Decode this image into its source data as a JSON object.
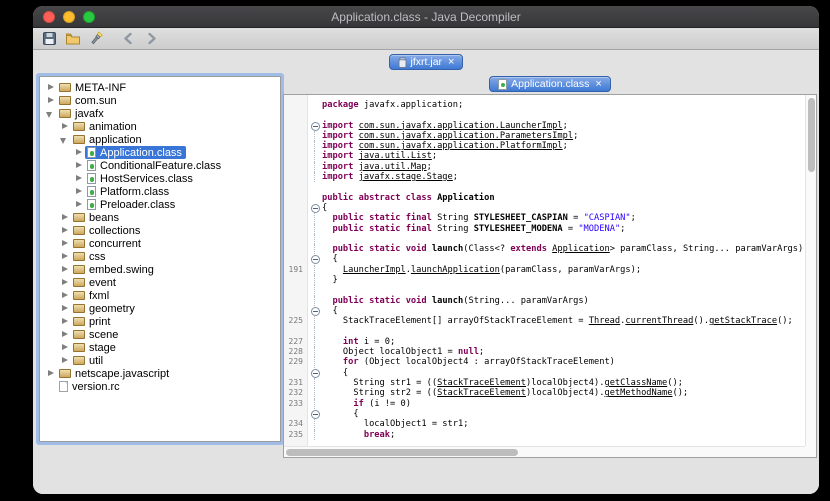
{
  "window": {
    "title": "Application.class - Java Decompiler"
  },
  "toolbar": {
    "icons": [
      "save-icon",
      "open-folder-icon",
      "search-flashlight-icon",
      "back-icon",
      "forward-icon"
    ]
  },
  "jar_tab": {
    "label": "jfxrt.jar",
    "close_glyph": "×"
  },
  "source_tab": {
    "label": "Application.class",
    "close_glyph": "×"
  },
  "colors": {
    "selection": "#3875d7",
    "tab_blue": "#3e79d6",
    "tab_blue_top": "#87aae6",
    "keyword": "#7f0055",
    "string": "#2a00ff",
    "traffic_red": "#ff5f57",
    "traffic_yellow": "#febc2e",
    "traffic_green": "#28c840"
  },
  "tree": {
    "items": [
      {
        "label": "META-INF",
        "depth": 0,
        "arrow": "right",
        "icon": "package"
      },
      {
        "label": "com.sun",
        "depth": 0,
        "arrow": "right",
        "icon": "package"
      },
      {
        "label": "javafx",
        "depth": 0,
        "arrow": "down",
        "icon": "package"
      },
      {
        "label": "animation",
        "depth": 1,
        "arrow": "right",
        "icon": "package"
      },
      {
        "label": "application",
        "depth": 1,
        "arrow": "down",
        "icon": "package"
      },
      {
        "label": "Application.class",
        "depth": 2,
        "arrow": "right",
        "icon": "class",
        "selected": true
      },
      {
        "label": "ConditionalFeature.class",
        "depth": 2,
        "arrow": "right",
        "icon": "class"
      },
      {
        "label": "HostServices.class",
        "depth": 2,
        "arrow": "right",
        "icon": "class"
      },
      {
        "label": "Platform.class",
        "depth": 2,
        "arrow": "right",
        "icon": "class"
      },
      {
        "label": "Preloader.class",
        "depth": 2,
        "arrow": "right",
        "icon": "class"
      },
      {
        "label": "beans",
        "depth": 1,
        "arrow": "right",
        "icon": "package"
      },
      {
        "label": "collections",
        "depth": 1,
        "arrow": "right",
        "icon": "package"
      },
      {
        "label": "concurrent",
        "depth": 1,
        "arrow": "right",
        "icon": "package"
      },
      {
        "label": "css",
        "depth": 1,
        "arrow": "right",
        "icon": "package"
      },
      {
        "label": "embed.swing",
        "depth": 1,
        "arrow": "right",
        "icon": "package"
      },
      {
        "label": "event",
        "depth": 1,
        "arrow": "right",
        "icon": "package"
      },
      {
        "label": "fxml",
        "depth": 1,
        "arrow": "right",
        "icon": "package"
      },
      {
        "label": "geometry",
        "depth": 1,
        "arrow": "right",
        "icon": "package"
      },
      {
        "label": "print",
        "depth": 1,
        "arrow": "right",
        "icon": "package"
      },
      {
        "label": "scene",
        "depth": 1,
        "arrow": "right",
        "icon": "package"
      },
      {
        "label": "stage",
        "depth": 1,
        "arrow": "right",
        "icon": "package"
      },
      {
        "label": "util",
        "depth": 1,
        "arrow": "right",
        "icon": "package"
      },
      {
        "label": "netscape.javascript",
        "depth": 0,
        "arrow": "right",
        "icon": "package"
      },
      {
        "label": "version.rc",
        "depth": 0,
        "arrow": "none",
        "icon": "file"
      }
    ]
  },
  "code": {
    "lines": [
      {
        "num": "",
        "fold": "",
        "ind": 0,
        "segs": [
          [
            "k",
            "package "
          ],
          [
            "p",
            "javafx.application;"
          ]
        ]
      },
      {
        "num": "",
        "fold": "",
        "ind": 0,
        "segs": []
      },
      {
        "num": "",
        "fold": "minus",
        "ind": 0,
        "segs": [
          [
            "k",
            "import "
          ],
          [
            "u",
            "com.sun.javafx.application.LauncherImpl"
          ],
          [
            "p",
            ";"
          ]
        ]
      },
      {
        "num": "",
        "fold": "line",
        "ind": 0,
        "segs": [
          [
            "k",
            "import "
          ],
          [
            "u",
            "com.sun.javafx.application.ParametersImpl"
          ],
          [
            "p",
            ";"
          ]
        ]
      },
      {
        "num": "",
        "fold": "line",
        "ind": 0,
        "segs": [
          [
            "k",
            "import "
          ],
          [
            "u",
            "com.sun.javafx.application.PlatformImpl"
          ],
          [
            "p",
            ";"
          ]
        ]
      },
      {
        "num": "",
        "fold": "line",
        "ind": 0,
        "segs": [
          [
            "k",
            "import "
          ],
          [
            "u",
            "java.util.List"
          ],
          [
            "p",
            ";"
          ]
        ]
      },
      {
        "num": "",
        "fold": "line",
        "ind": 0,
        "segs": [
          [
            "k",
            "import "
          ],
          [
            "u",
            "java.util.Map"
          ],
          [
            "p",
            ";"
          ]
        ]
      },
      {
        "num": "",
        "fold": "line",
        "ind": 0,
        "segs": [
          [
            "k",
            "import "
          ],
          [
            "u",
            "javafx.stage.Stage"
          ],
          [
            "p",
            ";"
          ]
        ]
      },
      {
        "num": "",
        "fold": "",
        "ind": 0,
        "segs": []
      },
      {
        "num": "",
        "fold": "",
        "ind": 0,
        "segs": [
          [
            "k",
            "public abstract class "
          ],
          [
            "d",
            "Application"
          ]
        ]
      },
      {
        "num": "",
        "fold": "minus",
        "ind": 0,
        "segs": [
          [
            "p",
            "{"
          ]
        ]
      },
      {
        "num": "",
        "fold": "line",
        "ind": 1,
        "segs": [
          [
            "k",
            "public static final "
          ],
          [
            "p",
            "String "
          ],
          [
            "d",
            "STYLESHEET_CASPIAN"
          ],
          [
            "p",
            " = "
          ],
          [
            "s",
            "\"CASPIAN\""
          ],
          [
            "p",
            ";"
          ]
        ]
      },
      {
        "num": "",
        "fold": "line",
        "ind": 1,
        "segs": [
          [
            "k",
            "public static final "
          ],
          [
            "p",
            "String "
          ],
          [
            "d",
            "STYLESHEET_MODENA"
          ],
          [
            "p",
            " = "
          ],
          [
            "s",
            "\"MODENA\""
          ],
          [
            "p",
            ";"
          ]
        ]
      },
      {
        "num": "",
        "fold": "line",
        "ind": 0,
        "segs": []
      },
      {
        "num": "",
        "fold": "line",
        "ind": 1,
        "segs": [
          [
            "k",
            "public static void "
          ],
          [
            "d",
            "launch"
          ],
          [
            "p",
            "(Class<? "
          ],
          [
            "k",
            "extends "
          ],
          [
            "u",
            "Application"
          ],
          [
            "p",
            "> paramClass, String... paramVarArgs)"
          ]
        ]
      },
      {
        "num": "",
        "fold": "minus",
        "ind": 1,
        "segs": [
          [
            "p",
            "{"
          ]
        ]
      },
      {
        "num": "191",
        "fold": "line",
        "ind": 2,
        "segs": [
          [
            "u",
            "LauncherImpl"
          ],
          [
            "p",
            "."
          ],
          [
            "u",
            "launchApplication"
          ],
          [
            "p",
            "(paramClass, paramVarArgs);"
          ]
        ]
      },
      {
        "num": "",
        "fold": "line",
        "ind": 1,
        "segs": [
          [
            "p",
            "}"
          ]
        ]
      },
      {
        "num": "",
        "fold": "line",
        "ind": 0,
        "segs": []
      },
      {
        "num": "",
        "fold": "line",
        "ind": 1,
        "segs": [
          [
            "k",
            "public static void "
          ],
          [
            "d",
            "launch"
          ],
          [
            "p",
            "(String... paramVarArgs)"
          ]
        ]
      },
      {
        "num": "",
        "fold": "minus",
        "ind": 1,
        "segs": [
          [
            "p",
            "{"
          ]
        ]
      },
      {
        "num": "225",
        "fold": "line",
        "ind": 2,
        "segs": [
          [
            "p",
            "StackTraceElement[] arrayOfStackTraceElement = "
          ],
          [
            "u",
            "Thread"
          ],
          [
            "p",
            "."
          ],
          [
            "u",
            "currentThread"
          ],
          [
            "p",
            "()."
          ],
          [
            "u",
            "getStackTrace"
          ],
          [
            "p",
            "();"
          ]
        ]
      },
      {
        "num": "",
        "fold": "line",
        "ind": 0,
        "segs": []
      },
      {
        "num": "227",
        "fold": "line",
        "ind": 2,
        "segs": [
          [
            "k",
            "int "
          ],
          [
            "p",
            "i = 0;"
          ]
        ]
      },
      {
        "num": "228",
        "fold": "line",
        "ind": 2,
        "segs": [
          [
            "p",
            "Object localObject1 = "
          ],
          [
            "k",
            "null"
          ],
          [
            "p",
            ";"
          ]
        ]
      },
      {
        "num": "229",
        "fold": "line",
        "ind": 2,
        "segs": [
          [
            "k",
            "for "
          ],
          [
            "p",
            "(Object localObject4 : arrayOfStackTraceElement)"
          ]
        ]
      },
      {
        "num": "",
        "fold": "minus",
        "ind": 2,
        "segs": [
          [
            "p",
            "{"
          ]
        ]
      },
      {
        "num": "231",
        "fold": "line",
        "ind": 3,
        "segs": [
          [
            "p",
            "String str1 = (("
          ],
          [
            "u",
            "StackTraceElement"
          ],
          [
            "p",
            ")localObject4)."
          ],
          [
            "u",
            "getClassName"
          ],
          [
            "p",
            "();"
          ]
        ]
      },
      {
        "num": "232",
        "fold": "line",
        "ind": 3,
        "segs": [
          [
            "p",
            "String str2 = (("
          ],
          [
            "u",
            "StackTraceElement"
          ],
          [
            "p",
            ")localObject4)."
          ],
          [
            "u",
            "getMethodName"
          ],
          [
            "p",
            "();"
          ]
        ]
      },
      {
        "num": "233",
        "fold": "line",
        "ind": 3,
        "segs": [
          [
            "k",
            "if "
          ],
          [
            "p",
            "(i != 0)"
          ]
        ]
      },
      {
        "num": "",
        "fold": "minus",
        "ind": 3,
        "segs": [
          [
            "p",
            "{"
          ]
        ]
      },
      {
        "num": "234",
        "fold": "line",
        "ind": 4,
        "segs": [
          [
            "p",
            "localObject1 = str1;"
          ]
        ]
      },
      {
        "num": "235",
        "fold": "line",
        "ind": 4,
        "segs": [
          [
            "k",
            "break"
          ],
          [
            "p",
            ";"
          ]
        ]
      }
    ]
  }
}
